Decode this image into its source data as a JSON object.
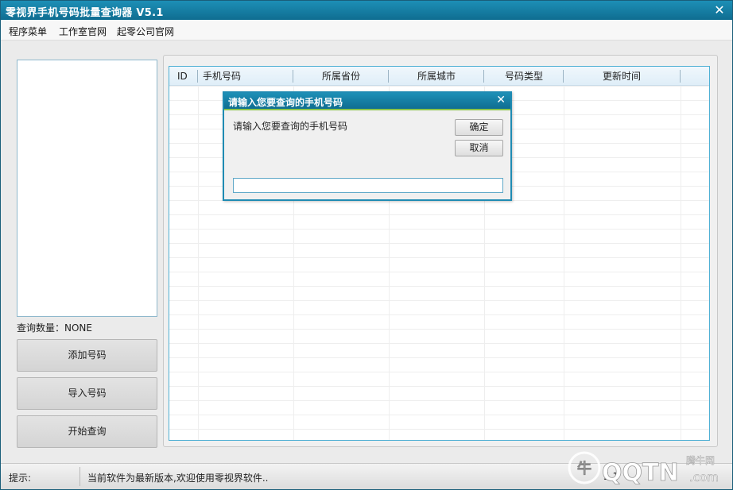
{
  "window": {
    "title": "零视界手机号码批量查询器 V5.1"
  },
  "menu": [
    "程序菜单",
    "工作室官网",
    "起零公司官网"
  ],
  "left": {
    "count_label": "查询数量：NONE",
    "buttons": [
      "添加号码",
      "导入号码",
      "开始查询"
    ]
  },
  "grid": {
    "columns": [
      "ID",
      "手机号码",
      "所属省份",
      "所属城市",
      "号码类型",
      "更新时间"
    ]
  },
  "dialog": {
    "title": "请输入您要查询的手机号码",
    "prompt": "请输入您要查询的手机号码",
    "ok_label": "确定",
    "cancel_label": "取消",
    "input_value": ""
  },
  "status": {
    "label": "提示:",
    "message": "当前软件为最新版本,欢迎使用零视界软件..",
    "version_fragment": "5.1"
  },
  "watermark": {
    "brand": "QQTN",
    "suffix": ".com",
    "cn": "腾牛网"
  },
  "colors": {
    "titlebar": "#1785ad",
    "accent_border": "#4fb0d4",
    "dialog_strip": "#8bc34a"
  }
}
